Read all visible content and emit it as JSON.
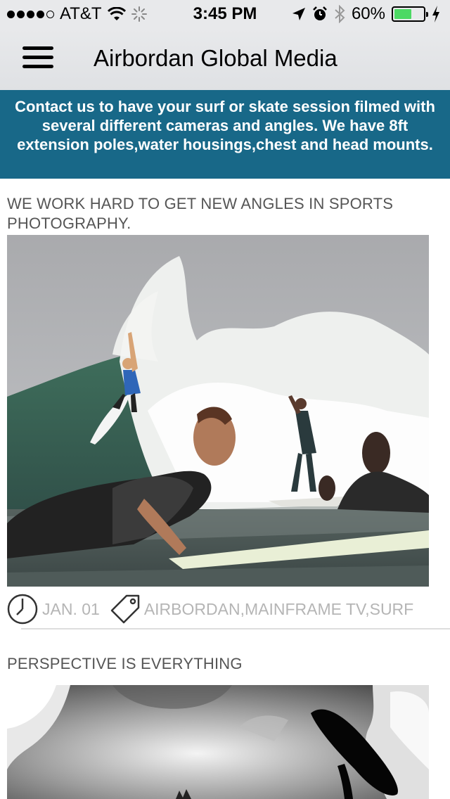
{
  "status_bar": {
    "carrier": "AT&T",
    "time": "3:45 PM",
    "battery": "60%",
    "battery_level": 0.6
  },
  "nav": {
    "title": "Airbordan Global Media"
  },
  "banner": {
    "text": "Contact us to have your surf or skate session filmed with several different cameras and angles. We have 8ft extension poles,water housings,chest and head mounts."
  },
  "posts": [
    {
      "title": "WE WORK HARD TO GET NEW ANGLES IN SPORTS PHOTOGRAPHY.",
      "date": "JAN. 01",
      "tags": "AIRBORDAN,MAINFRAME TV,SURF"
    },
    {
      "title": "PERSPECTIVE IS EVERYTHING"
    }
  ],
  "icons": {
    "menu": "hamburger-menu-icon",
    "clock": "clock-icon",
    "tag": "tag-icon"
  },
  "colors": {
    "banner_bg": "#186888",
    "meta_text": "#b5b5b5",
    "title_text": "#555555"
  }
}
